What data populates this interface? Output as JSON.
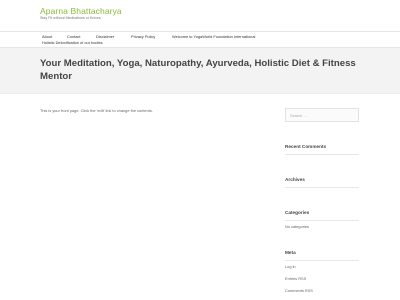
{
  "site": {
    "title": "Aparna Bhattacharya",
    "tagline": "Stay Fit without Medications or Knives"
  },
  "nav": {
    "items": [
      {
        "label": "About"
      },
      {
        "label": "Contact"
      },
      {
        "label": "Disclaimer"
      },
      {
        "label": "Privacy Policy"
      },
      {
        "label": "Welcome to YogaWorld Foundation International"
      },
      {
        "label": "Holistic Detoxification of our bodies"
      }
    ]
  },
  "page": {
    "title": "Your Meditation, Yoga, Naturopathy, Ayurveda, Holistic Diet & Fitness Mentor",
    "content": "This is your front page. Click the 'edit' link to change the contents."
  },
  "sidebar": {
    "search_placeholder": "Search …",
    "recent_comments_title": "Recent Comments",
    "archives_title": "Archives",
    "categories_title": "Categories",
    "categories_empty": "No categories",
    "meta_title": "Meta",
    "meta_links": [
      {
        "label": "Log in"
      },
      {
        "label": "Entries RSS"
      },
      {
        "label": "Comments RSS"
      }
    ]
  }
}
